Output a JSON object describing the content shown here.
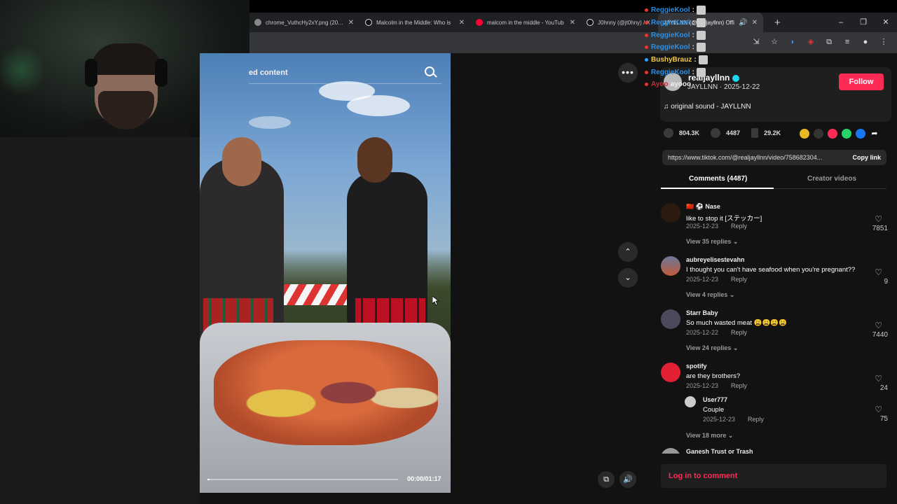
{
  "browser": {
    "tabs": [
      {
        "label": "chrome_VuthcHy2xY.png (2024",
        "color": "#888888"
      },
      {
        "label": "Malcolm in the Middle: Who is",
        "color": "#111111"
      },
      {
        "label": "malcom in the middle - YouTub",
        "color": "#ff0033"
      },
      {
        "label": "J0hnny (@jt0hny) / X",
        "color": "#111111"
      },
      {
        "label": "JAYLLNN (@realjayllnn) Offi",
        "color": "#111111",
        "active": true
      }
    ],
    "new_tab": "+",
    "window_buttons": [
      "–",
      "❐",
      "✕"
    ]
  },
  "chat": [
    {
      "user": "ReggieKool",
      "color": "blue",
      "dot": "red",
      "message": ""
    },
    {
      "user": "ReggieKool",
      "color": "blue",
      "dot": "red",
      "message": ""
    },
    {
      "user": "ReggieKool",
      "color": "blue",
      "dot": "red",
      "message": ""
    },
    {
      "user": "ReggieKool",
      "color": "blue",
      "dot": "red",
      "message": ""
    },
    {
      "user": "BushyBrauz",
      "color": "gold",
      "dot": "blue",
      "message": ""
    },
    {
      "user": "ReggieKool",
      "color": "blue",
      "dot": "red",
      "message": ""
    },
    {
      "user": "Ayoo",
      "color": "red",
      "dot": "red",
      "message": "ayooo"
    }
  ],
  "video": {
    "search_text": "ed content",
    "time": "00:00/01:17",
    "progress": 0.01
  },
  "author": {
    "username": "realjayllnn",
    "nickname": "JAYLLNN · 2025-12-22",
    "follow": "Follow",
    "sound": "♫  original sound - JAYLLNN"
  },
  "stats": {
    "likes": "804.3K",
    "comments": "4487",
    "saves": "29.2K"
  },
  "link": {
    "url": "https://www.tiktok.com/@realjayllnn/video/758682304...",
    "copy": "Copy link"
  },
  "tabs": {
    "comments": "Comments (4487)",
    "creator": "Creator videos"
  },
  "comments": [
    {
      "name": "🇨🇳 ⚽ Nase",
      "text": "like to stop it [ステッカー]",
      "date": "2025-12-23",
      "reply": "Reply",
      "likes": "7851",
      "view": "View 35 replies ⌄",
      "avatar": "#3a2a1a"
    },
    {
      "name": "aubreyelisestevahn",
      "text": "I thought you can't have seafood when you're pregnant??",
      "date": "2025-12-23",
      "reply": "Reply",
      "likes": "9",
      "view": "View 4 replies ⌄",
      "avatar": "#6a6a8a"
    },
    {
      "name": "Starr Baby",
      "text": "So much wasted meat 😩😩😩😩",
      "date": "2025-12-22",
      "reply": "Reply",
      "likes": "7440",
      "view": "View 24 replies ⌄",
      "avatar": "#555566"
    },
    {
      "name": "spotify",
      "text": "are they brothers?",
      "date": "2025-12-23",
      "reply": "Reply",
      "likes": "24",
      "view": "",
      "avatar": "#e22134"
    },
    {
      "name": "Ganesh Trust or Trash",
      "text": "",
      "date": "",
      "reply": "",
      "likes": "",
      "view": "",
      "avatar": "#999999"
    }
  ],
  "subcomment": {
    "name": "User777",
    "text": "Couple",
    "date": "2025-12-23",
    "reply": "Reply",
    "likes": "75",
    "avatar": "#cccccc"
  },
  "view_more": "View 18 more ⌄",
  "login": "Log in to comment"
}
